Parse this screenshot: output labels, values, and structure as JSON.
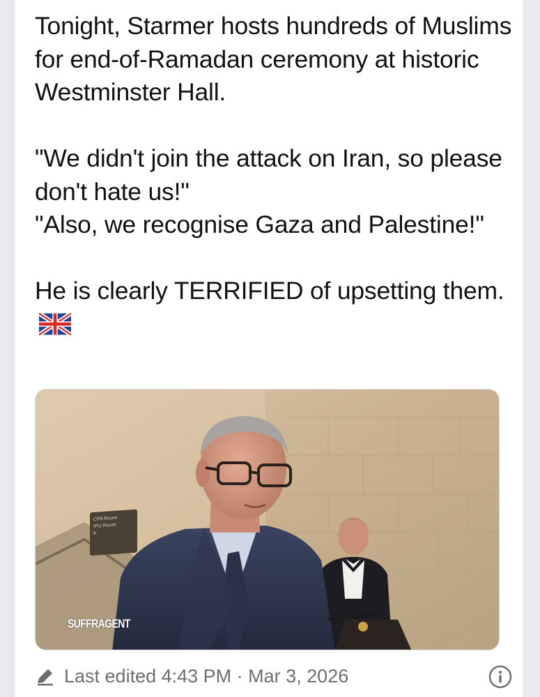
{
  "post": {
    "paragraph1": "Tonight, Starmer hosts hundreds of Muslims for end-of-Ramadan ceremony at historic Westminster Hall.",
    "quote1": "\"We didn't join the attack on Iran, so please don't hate us!\"",
    "quote2": "\"Also, we recognise Gaza and Palestine!\"",
    "paragraph3": "He is clearly TERRIFIED of upsetting them.",
    "emoji": "uk-flag"
  },
  "media": {
    "watermark": "SUFFRAGENT",
    "sign_line1": "CPA Room",
    "sign_line2": "IPU Room",
    "sign_line3": "K"
  },
  "meta": {
    "edited_label": "Last edited 4:43 PM · Mar 3, 2026",
    "edit_icon": "pencil-icon",
    "info_icon": "info-icon"
  },
  "colors": {
    "text": "#111111",
    "meta_text": "#6d6d72",
    "background": "#ffffff",
    "page_bg": "#e9e9ee"
  }
}
